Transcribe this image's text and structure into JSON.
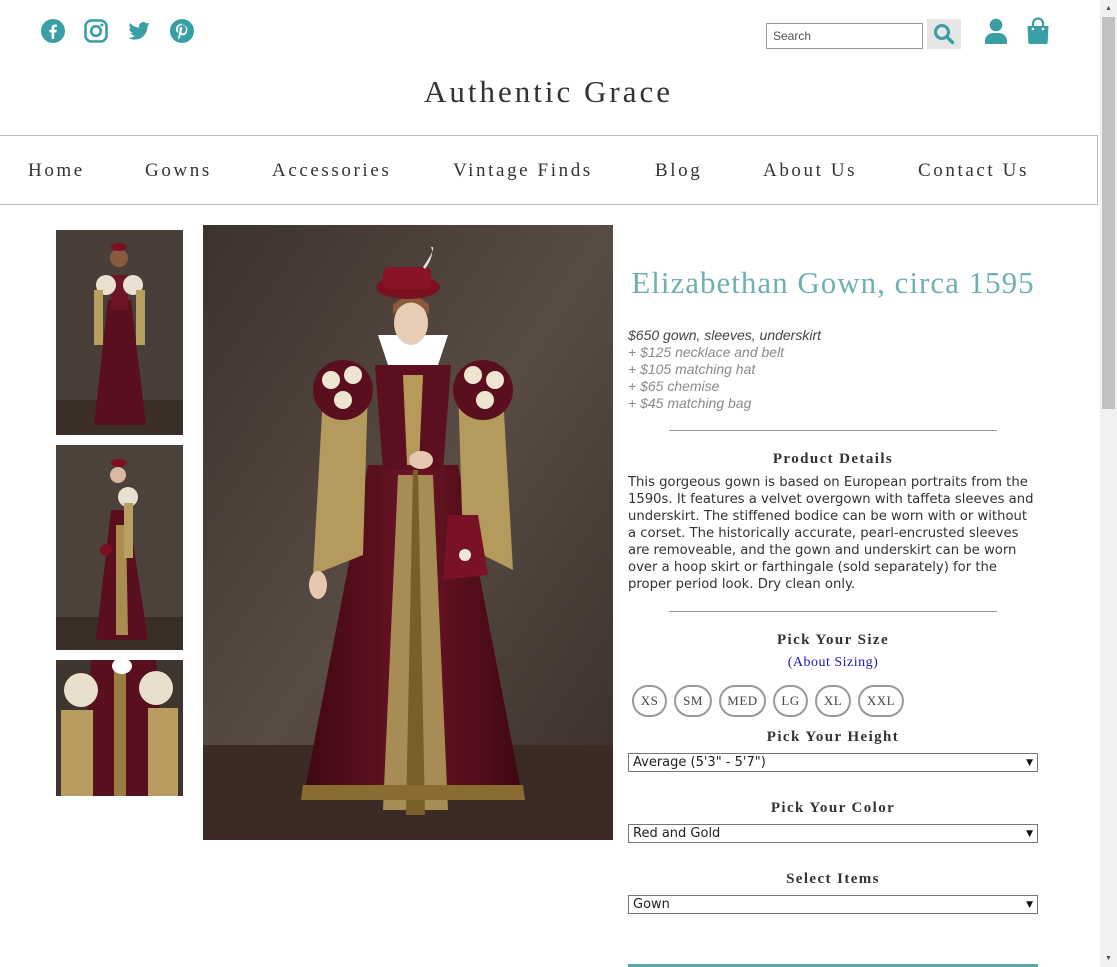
{
  "colors": {
    "accent": "#3a9ea5",
    "title": "#6fb0b4",
    "link": "#1a1ab0"
  },
  "social": [
    {
      "name": "facebook-icon"
    },
    {
      "name": "instagram-icon"
    },
    {
      "name": "twitter-icon"
    },
    {
      "name": "pinterest-icon"
    }
  ],
  "header": {
    "search_placeholder": "Search",
    "brand": "Authentic Grace"
  },
  "nav": {
    "items": [
      "Home",
      "Gowns",
      "Accessories",
      "Vintage Finds",
      "Blog",
      "About Us",
      "Contact Us"
    ]
  },
  "product": {
    "title": "Elizabethan Gown, circa 1595",
    "price_main": "$650 gown, sleeves, underskirt",
    "price_addons": [
      "+ $125 necklace and belt",
      "+ $105 matching hat",
      "+ $65 chemise",
      "+ $45 matching bag"
    ],
    "details_heading": "Product Details",
    "details_text": "This gorgeous gown is based on European portraits from the 1590s. It features a velvet overgown with taffeta sleeves and underskirt. The stiffened bodice can be worn with or without a corset. The historically accurate, pearl-encrusted sleeves are removeable, and the gown and underskirt can be worn over a hoop skirt or farthingale (sold separately) for the proper period look. Dry clean only.",
    "size_heading": "Pick Your Size",
    "sizing_link": "(About Sizing)",
    "sizes": [
      "XS",
      "SM",
      "MED",
      "LG",
      "XL",
      "XXL"
    ],
    "height_heading": "Pick Your Height",
    "height_value": "Average (5'3\" - 5'7\")",
    "color_heading": "Pick Your Color",
    "color_value": "Red and Gold",
    "items_heading": "Select Items",
    "items_value": "Gown"
  }
}
